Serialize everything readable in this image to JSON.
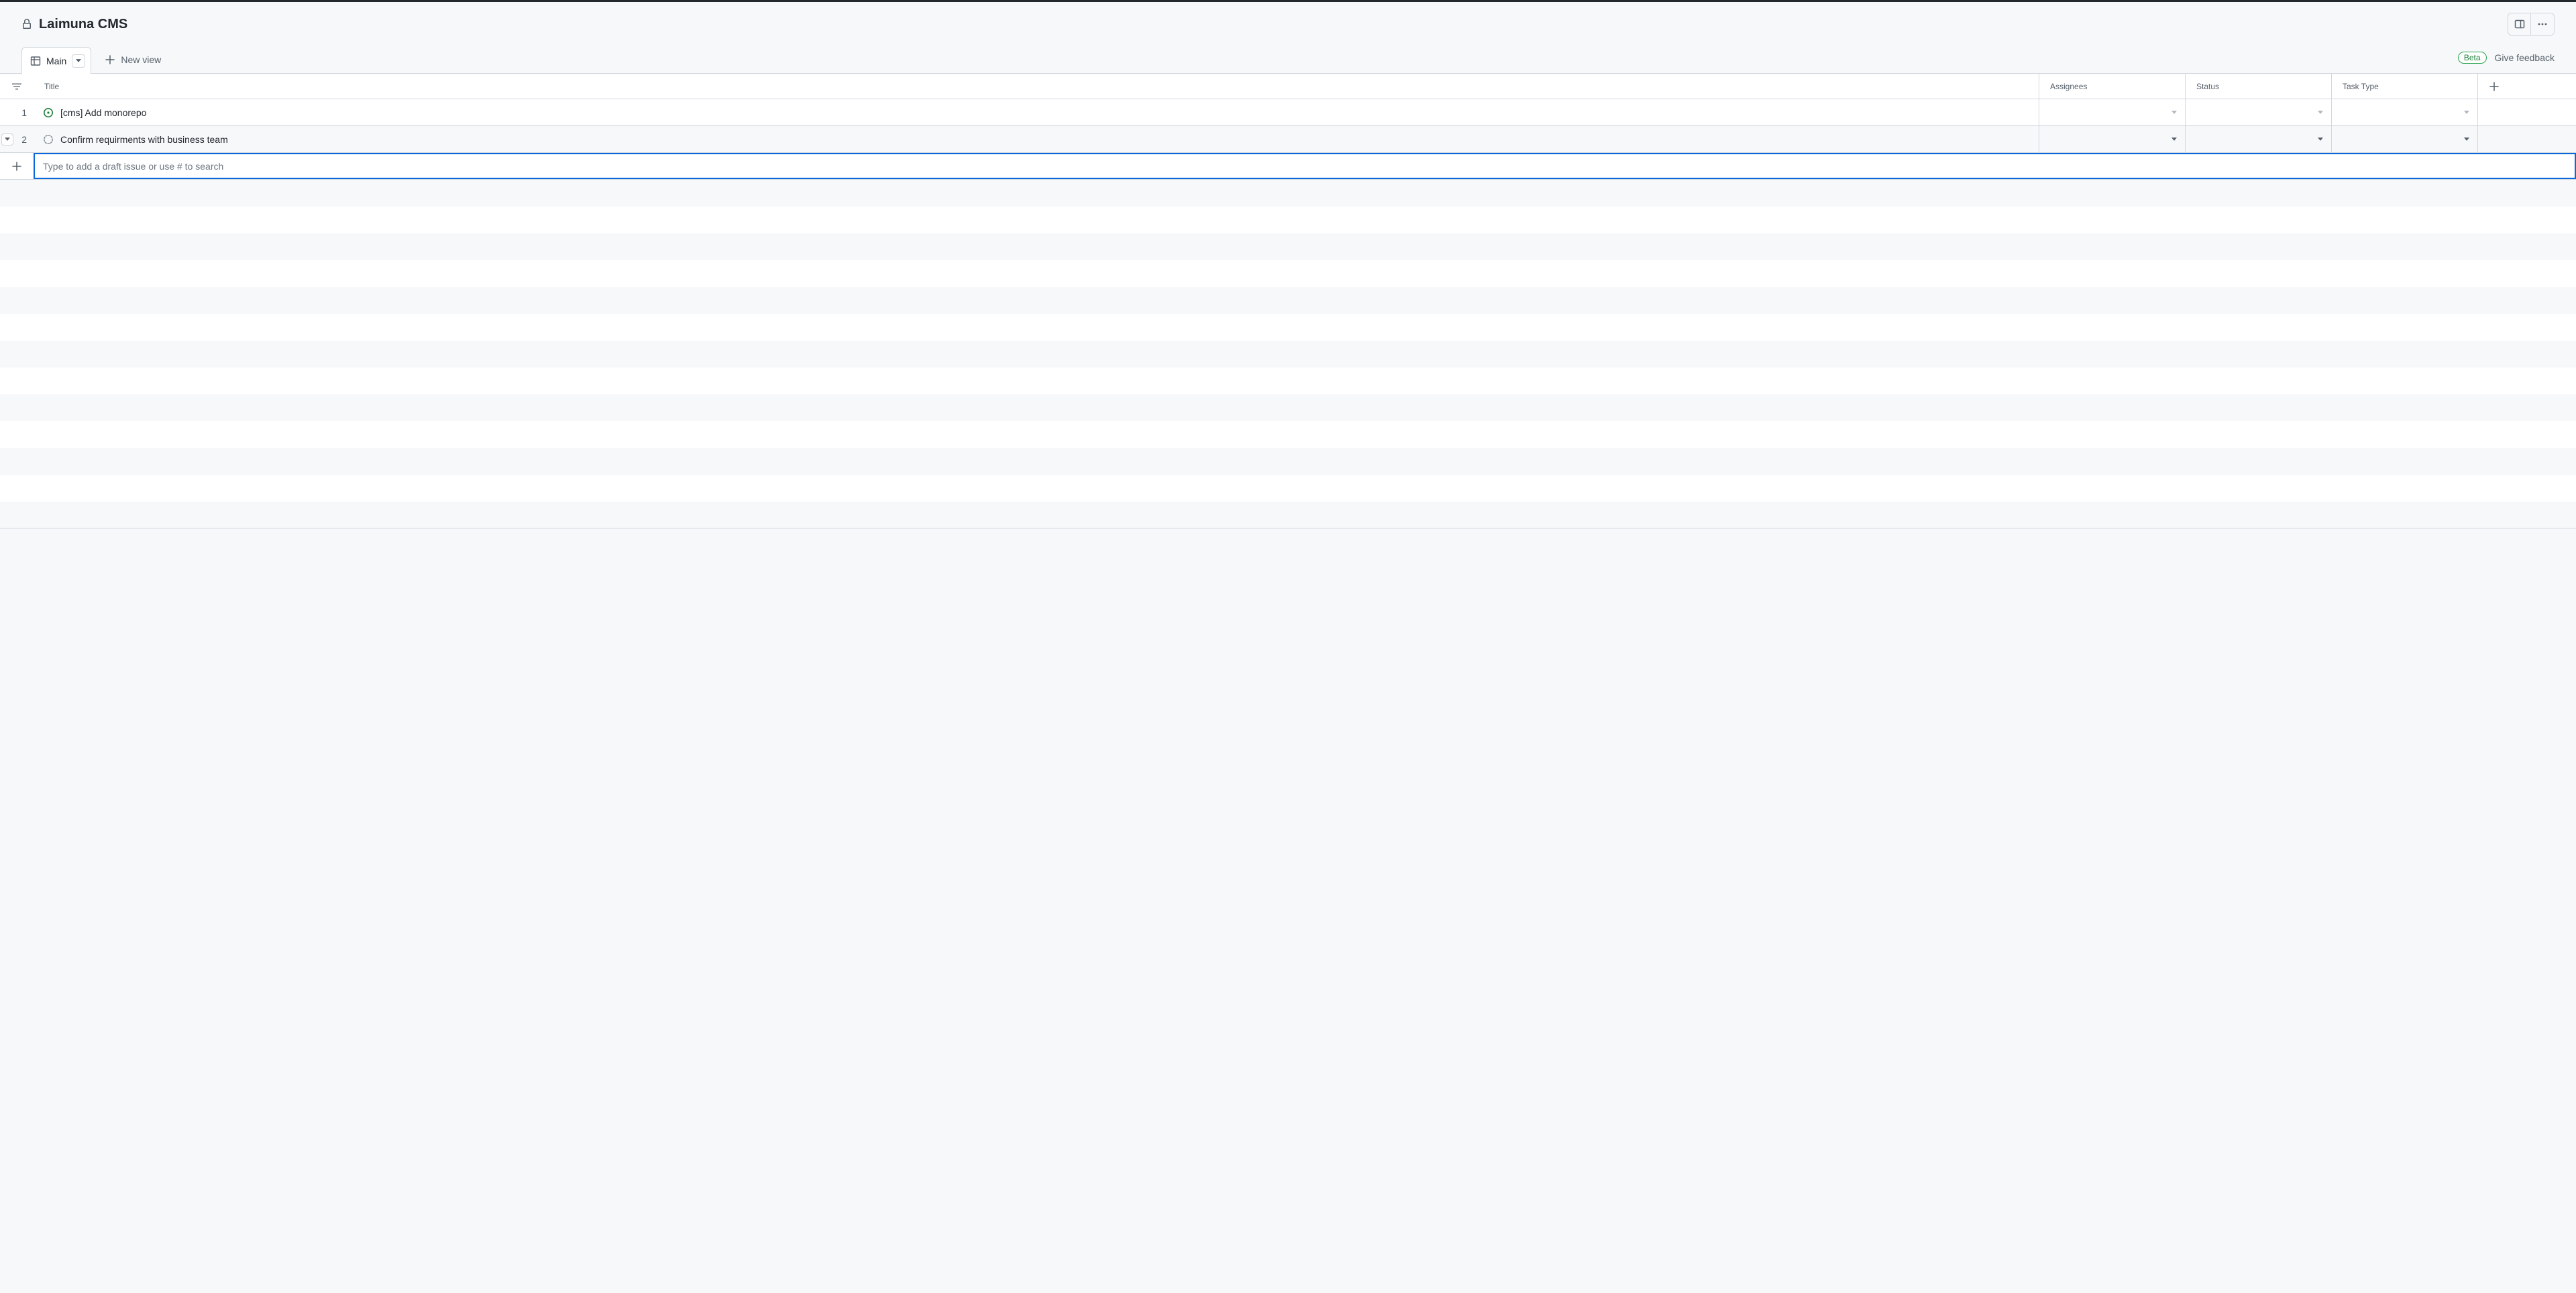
{
  "header": {
    "title": "Laimuna CMS"
  },
  "tabs": {
    "main_label": "Main",
    "new_view_label": "New view"
  },
  "badges": {
    "beta": "Beta",
    "feedback": "Give feedback"
  },
  "columns": {
    "title": "Title",
    "assignees": "Assignees",
    "status": "Status",
    "task_type": "Task Type"
  },
  "rows": [
    {
      "num": "1",
      "title": "[cms] Add monorepo",
      "type": "issue"
    },
    {
      "num": "2",
      "title": "Confirm requirments with business team",
      "type": "draft"
    }
  ],
  "input": {
    "placeholder": "Type to add a draft issue or use # to search"
  }
}
